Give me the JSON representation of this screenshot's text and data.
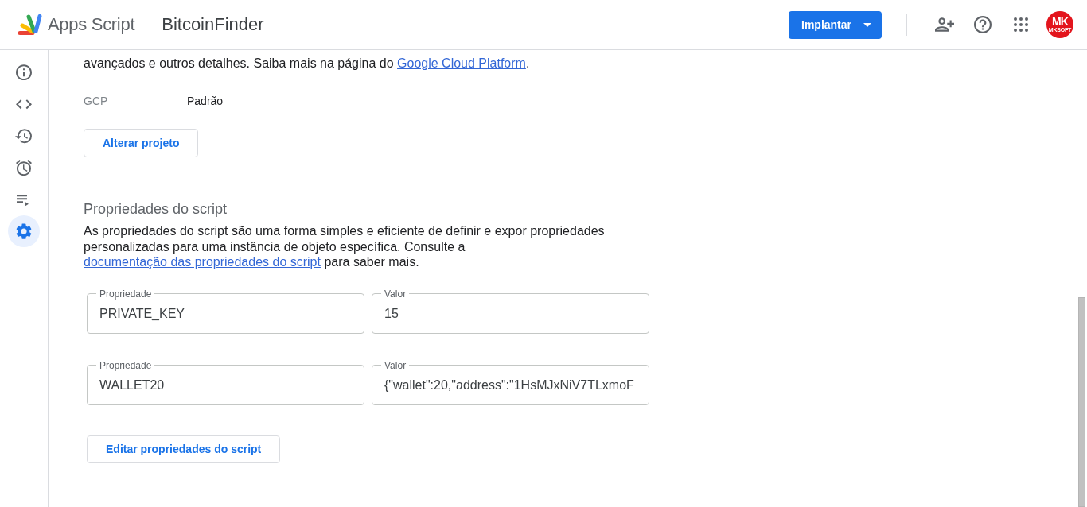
{
  "header": {
    "product_name": "Apps Script",
    "project_title": "BitcoinFinder",
    "deploy_button": "Implantar",
    "avatar": {
      "initials": "MK",
      "caption": "MKSOFT"
    }
  },
  "sidebar": {
    "items": [
      {
        "kind": "overview",
        "selected": false
      },
      {
        "kind": "editor",
        "selected": false
      },
      {
        "kind": "history",
        "selected": false
      },
      {
        "kind": "triggers",
        "selected": false
      },
      {
        "kind": "executions",
        "selected": false
      },
      {
        "kind": "settings",
        "selected": true
      }
    ]
  },
  "gcp": {
    "description": "avançados e outros detalhes. Saiba mais na página do ",
    "link": "Google Cloud Platform",
    "description_end": ".",
    "rows": [
      {
        "label": "GCP",
        "value": "Padrão"
      }
    ],
    "button": "Alterar projeto"
  },
  "script_properties": {
    "title": "Propriedades do script",
    "description": "As propriedades do script são uma forma simples e eficiente de definir e expor propriedades personalizadas para uma instância de objeto específica. Consulte a ",
    "link": "documentação das propriedades do script",
    "description_end": " para saber mais.",
    "rows": [
      {
        "property_label": "Propriedade",
        "property": "PRIVATE_KEY",
        "value_label": "Valor",
        "value": "15"
      },
      {
        "property_label": "Propriedade",
        "property": "WALLET20",
        "value_label": "Valor",
        "value": "{\"wallet\":20,\"address\":\"1HsMJxNiV7TLxmoF"
      }
    ],
    "button": "Editar propriedades do script"
  }
}
